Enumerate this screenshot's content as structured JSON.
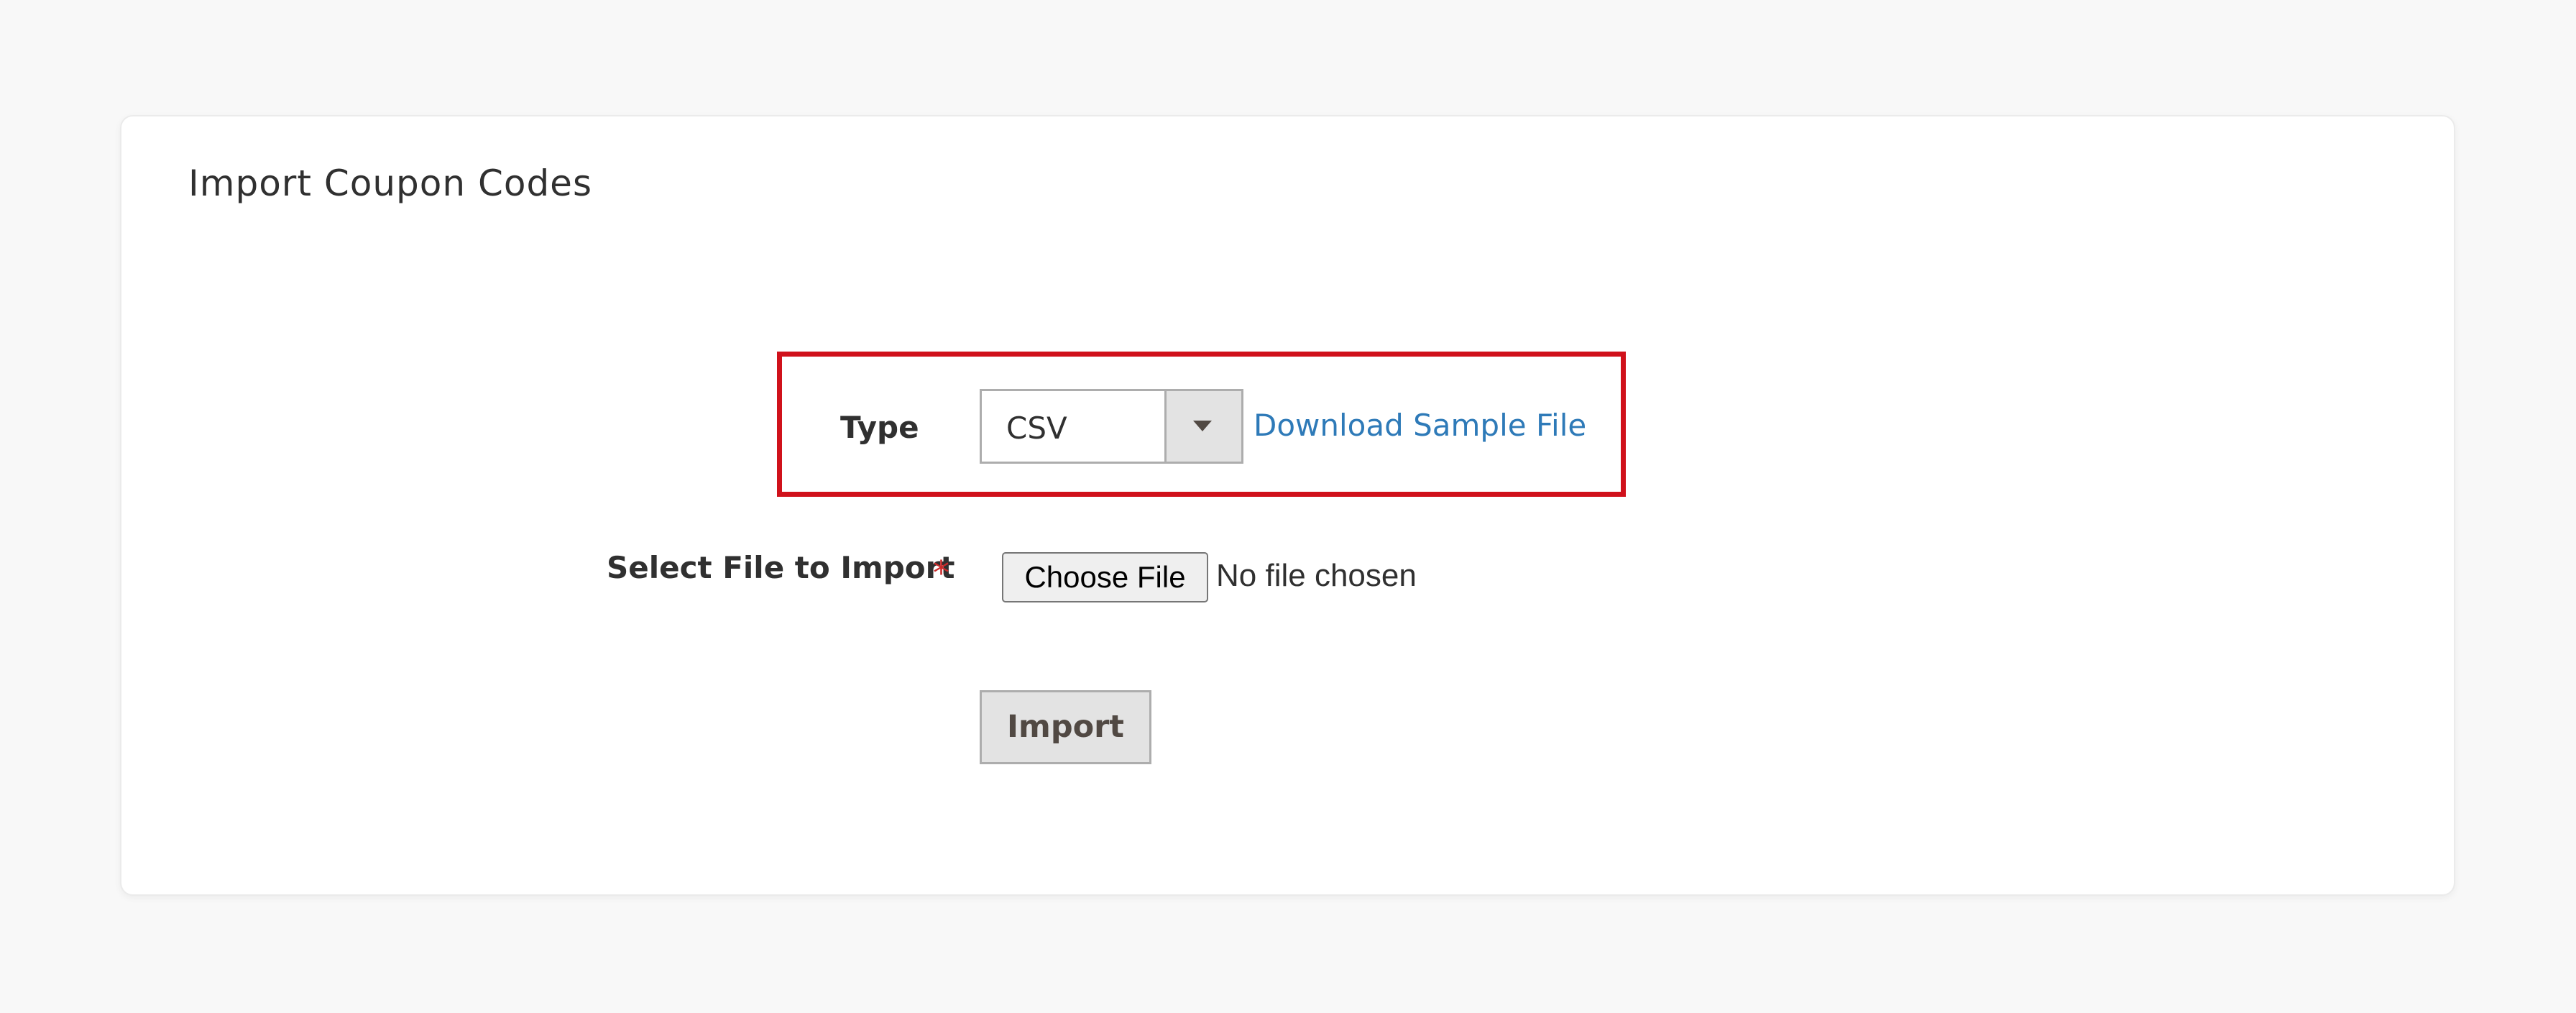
{
  "panel": {
    "title": "Import Coupon Codes"
  },
  "type_field": {
    "label": "Type",
    "selected_value": "CSV",
    "options": [
      "CSV"
    ],
    "dropdown_icon": "chevron-down-icon",
    "sample_link_label": "Download Sample File"
  },
  "file_field": {
    "label": "Select File to Import",
    "required_marker": "*",
    "choose_button_label": "Choose File",
    "status_text": "No file chosen"
  },
  "actions": {
    "import_label": "Import"
  },
  "colors": {
    "page_background": "#f8f8f8",
    "panel_background": "#ffffff",
    "highlight_border": "#d0111b",
    "link": "#2e7ab8",
    "required": "#c92a2a",
    "button_background": "#e3e3e3",
    "text": "#303030"
  }
}
